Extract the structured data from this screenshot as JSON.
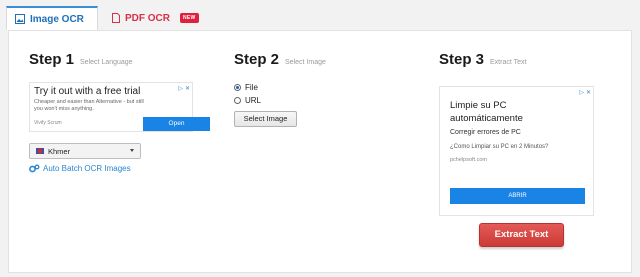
{
  "tabs": [
    {
      "label": "Image OCR",
      "active": true
    },
    {
      "label": "PDF OCR",
      "active": false,
      "badge": "NEW"
    }
  ],
  "steps": {
    "step1": {
      "title": "Step 1",
      "subtitle": "Select Language"
    },
    "step2": {
      "title": "Step 2",
      "subtitle": "Select Image"
    },
    "step3": {
      "title": "Step 3",
      "subtitle": "Extract Text"
    }
  },
  "ad1": {
    "title": "Try it out with a free trial",
    "description": "Cheaper and easier than Alternative - but still you won't miss anything.",
    "source": "Vivify Scrum",
    "button": "Open"
  },
  "language": {
    "selected": "Khmer"
  },
  "batch_link": "Auto Batch OCR Images",
  "source_options": [
    {
      "label": "File",
      "checked": true
    },
    {
      "label": "URL",
      "checked": false
    }
  ],
  "select_image_button": "Select Image",
  "ad2": {
    "title_line1": "Limpie su PC",
    "title_line2": "automáticamente",
    "subtitle": "Corregir errores de PC",
    "question": "¿Como Limpiar su PC en 2 Minutos?",
    "source": "pchelpsoft.com",
    "button": "ABRIR"
  },
  "extract_button": "Extract Text",
  "colors": {
    "accent_blue": "#2a86d3",
    "pdf_red": "#d9304a",
    "extract_red": "#d9433f"
  }
}
